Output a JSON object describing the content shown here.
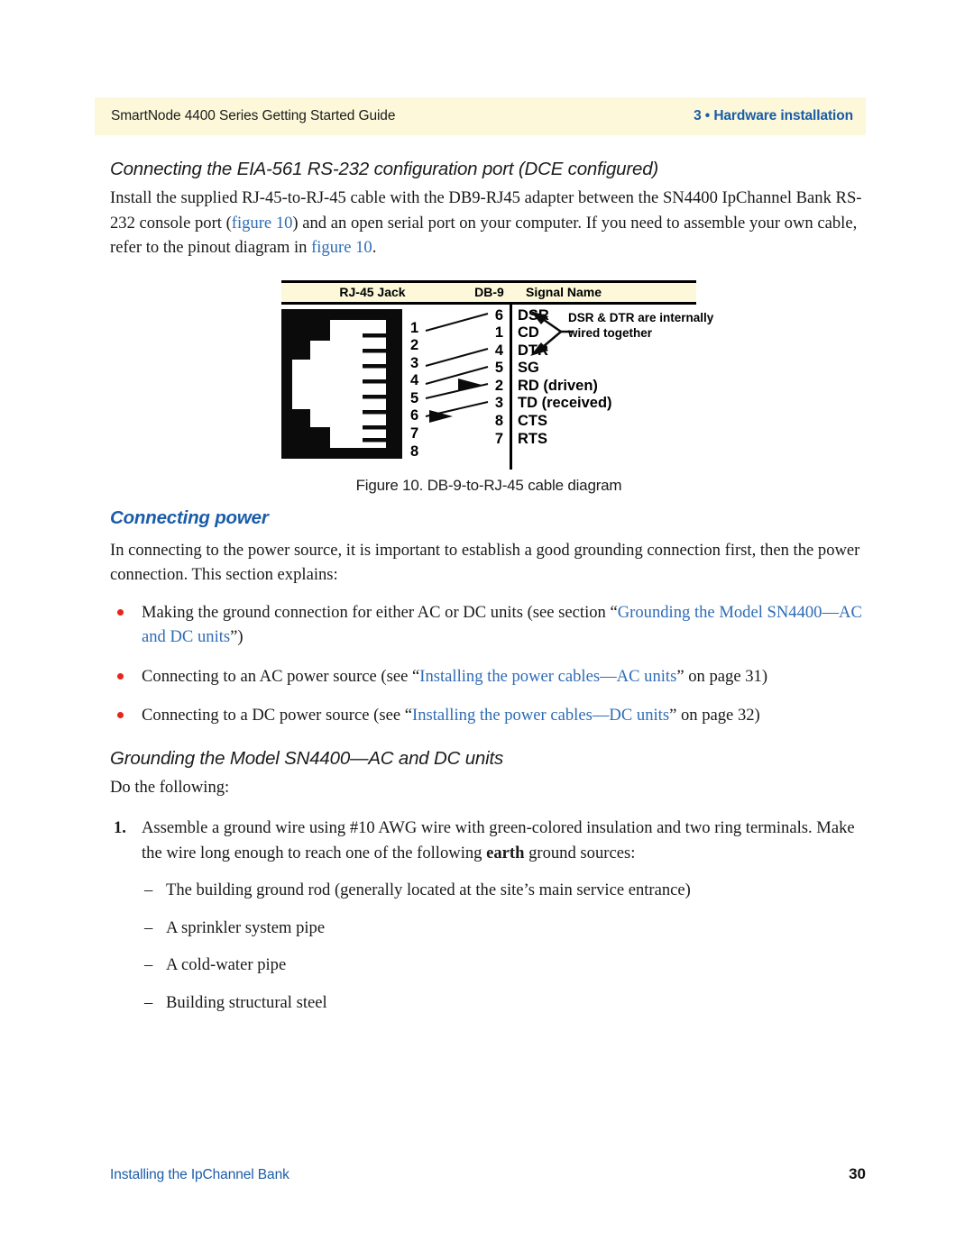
{
  "header": {
    "left_text": "SmartNode 4400 Series Getting Started Guide",
    "right_text": "3 • Hardware installation",
    "band_color": "#fcf8d9",
    "accent_blue": "#1a5ca8"
  },
  "section": {
    "heading": "Connecting the EIA-561 RS-232 configuration port (DCE configured)",
    "intro_part1": "Install the supplied RJ-45-to-RJ-45 cable with the DB9-RJ45 adapter between the SN4400 IpChannel Bank RS-232 console port (",
    "intro_link1": "figure 10",
    "intro_part2": ") and an open serial port on your computer. If you need to assemble your own cable, refer to the pinout diagram in ",
    "intro_link2": "figure 10",
    "intro_part3": "."
  },
  "figure": {
    "caption": "Figure 10. DB-9-to-RJ-45 cable diagram",
    "columns": [
      "RJ-45 Jack",
      "DB-9",
      "Signal Name"
    ],
    "rows": [
      {
        "rj45": "",
        "db9": "6",
        "signal": "DSR"
      },
      {
        "rj45": "1",
        "db9": "1",
        "signal": "CD"
      },
      {
        "rj45": "2",
        "db9": "4",
        "signal": "DTR"
      },
      {
        "rj45": "3",
        "db9": "5",
        "signal": "SG"
      },
      {
        "rj45": "4",
        "db9": "2",
        "signal": "RD (driven)"
      },
      {
        "rj45": "5",
        "db9": "3",
        "signal": "TD (received)"
      },
      {
        "rj45": "6",
        "db9": "8",
        "signal": "CTS"
      },
      {
        "rj45": "7",
        "db9": "7",
        "signal": "RTS"
      },
      {
        "rj45": "8",
        "db9": "",
        "signal": ""
      }
    ],
    "rj45_pins": [
      "1",
      "2",
      "3",
      "4",
      "5",
      "6",
      "7",
      "8"
    ],
    "db9_pins": [
      "6",
      "1",
      "4",
      "5",
      "2",
      "3",
      "8",
      "7"
    ],
    "signal_names": [
      "DSR",
      "CD",
      "DTR",
      "SG",
      "RD (driven)",
      "TD (received)",
      "CTS",
      "RTS"
    ],
    "connections": [
      {
        "rj45_pin": "1",
        "db9_pin": "6",
        "signal": "DSR",
        "arrow": "none"
      },
      {
        "rj45_pin": "3",
        "db9_pin": "4",
        "signal": "DTR",
        "arrow": "none"
      },
      {
        "rj45_pin": "4",
        "db9_pin": "5",
        "signal": "SG",
        "arrow": "none"
      },
      {
        "rj45_pin": "5",
        "db9_pin": "2",
        "signal": "RD (driven)",
        "arrow": "right"
      },
      {
        "rj45_pin": "6",
        "db9_pin": "3",
        "signal": "TD (received)",
        "arrow": "left"
      }
    ],
    "annotation_line1": "DSR & DTR are internally",
    "annotation_line2": "wired together"
  },
  "power": {
    "heading": "Connecting power",
    "intro": "In connecting to the power source, it is important to establish a good grounding connection first, then the power connection. This section explains:",
    "bullets": [
      {
        "pre": "Making the ground connection for either AC or DC units (see section “",
        "link": "Grounding the Model SN4400—AC and DC units",
        "post": "”)"
      },
      {
        "pre": "Connecting to an AC power source (see “",
        "link": "Installing the power cables—AC units",
        "post": "” on page 31)"
      },
      {
        "pre": "Connecting to a DC power source (see “",
        "link": "Installing the power cables—DC units",
        "post": "” on page 32)"
      }
    ]
  },
  "grounding": {
    "heading": "Grounding the Model SN4400—AC and DC units",
    "intro": "Do the following:",
    "steps": [
      {
        "number": "1.",
        "pre": "Assemble a ground wire using #10 AWG wire with green-colored insulation and two ring terminals. Make the wire long enough to reach one of the following ",
        "bold": "earth",
        "post": " ground sources:"
      }
    ],
    "sources": [
      "The building ground rod (generally located at the site’s main service entrance)",
      "A sprinkler system pipe",
      "A cold-water pipe",
      "Building structural steel"
    ],
    "dash": "–"
  },
  "footer": {
    "left_text": "Installing the IpChannel Bank",
    "page_number": "30"
  }
}
